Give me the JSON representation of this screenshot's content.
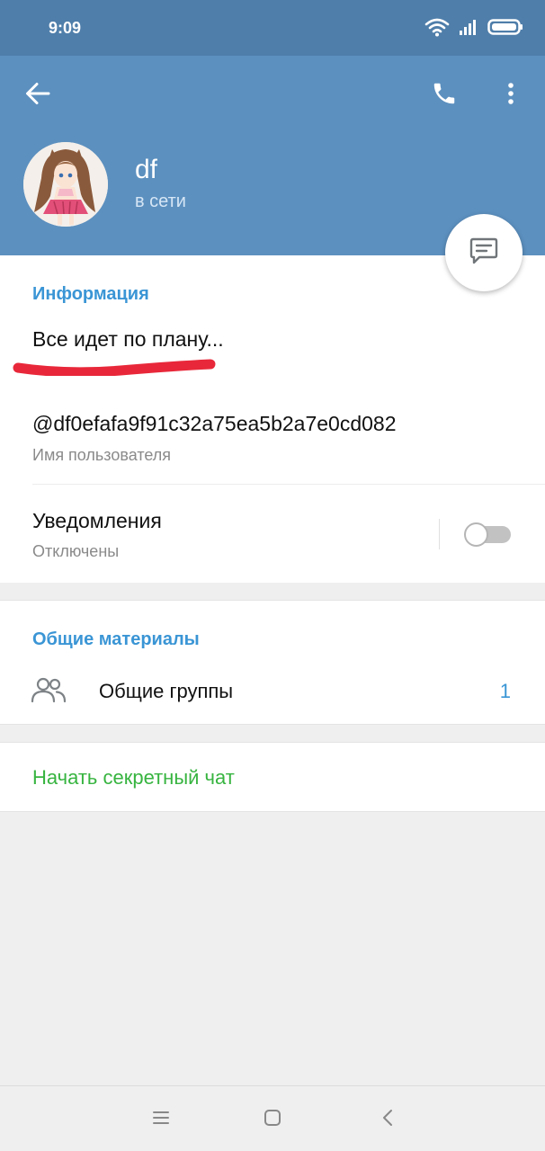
{
  "status_bar": {
    "time": "9:09",
    "icons": [
      "wifi-icon",
      "signal-icon",
      "battery-icon"
    ]
  },
  "header": {
    "icons": [
      "arrow-left-icon",
      "phone-icon",
      "more-vertical-icon"
    ],
    "name": "df",
    "status": "в сети",
    "background_color": "#5c90bf"
  },
  "fab": {
    "icon": "message-icon"
  },
  "info": {
    "section_title": "Информация",
    "about": "Все идет по плану...",
    "username": "@df0efafa9f91c32a75ea5b2a7e0cd082",
    "username_caption": "Имя пользователя",
    "notifications_label": "Уведомления",
    "notifications_state": "Отключены",
    "notifications_enabled": false
  },
  "shared": {
    "section_title": "Общие материалы",
    "groups_label": "Общие группы",
    "groups_count": "1"
  },
  "secret_chat": {
    "label": "Начать секретный чат",
    "color": "#37b440"
  },
  "colors": {
    "accent": "#3a95d5",
    "annotation_red": "#e8283a"
  }
}
